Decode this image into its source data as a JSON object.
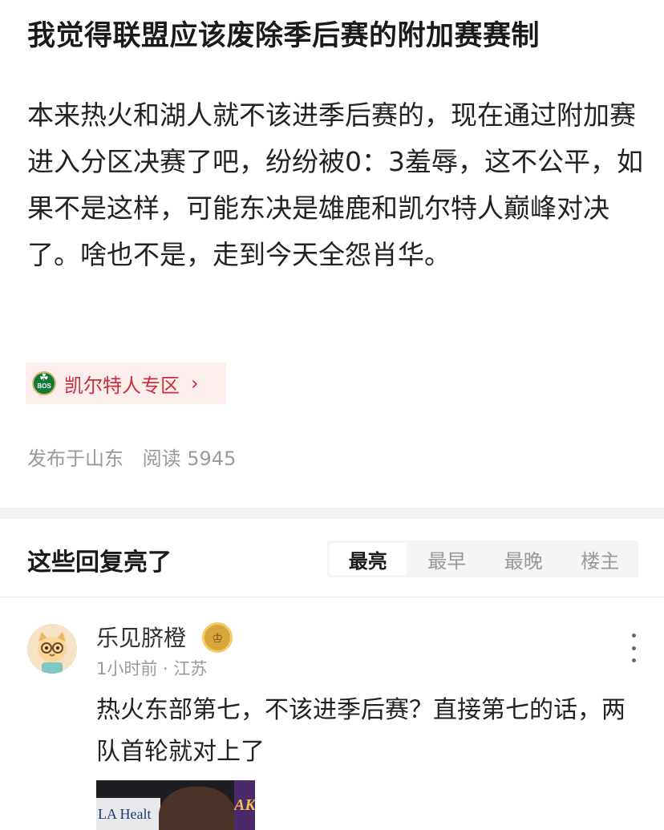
{
  "post": {
    "title": "我觉得联盟应该废除季后赛的附加赛赛制",
    "body": "本来热火和湖人就不该进季后赛的，现在通过附加赛进入分区决赛了吧，纷纷被0：3羞辱，这不公平，如果不是这样，可能东决是雄鹿和凯尔特人巅峰对决了。啥也不是，走到今天全怨肖华。",
    "zone": {
      "logo_text": "BOS",
      "label": "凯尔特人专区",
      "chevron": "›",
      "logo_icon": "celtics-logo-icon"
    },
    "published": "发布于山东",
    "read_count": "阅读 5945"
  },
  "replies": {
    "title": "这些回复亮了",
    "sort_tabs": [
      "最亮",
      "最早",
      "最晚",
      "楼主"
    ],
    "active_tab": 0
  },
  "comment": {
    "username": "乐见脐橙",
    "badge_icon": "level-badge-icon",
    "meta": "1小时前 · 江苏",
    "text": "热火东部第七，不该进季后赛？直接第七的话，两队首轮就对上了",
    "image": {
      "left_text": "LA Healt",
      "right_text": "AKE"
    }
  },
  "colors": {
    "accent_red": "#c9303c",
    "zone_bg": "#fdeeee",
    "muted_text": "#9a9a9a",
    "divider": "#f2f2f4"
  }
}
